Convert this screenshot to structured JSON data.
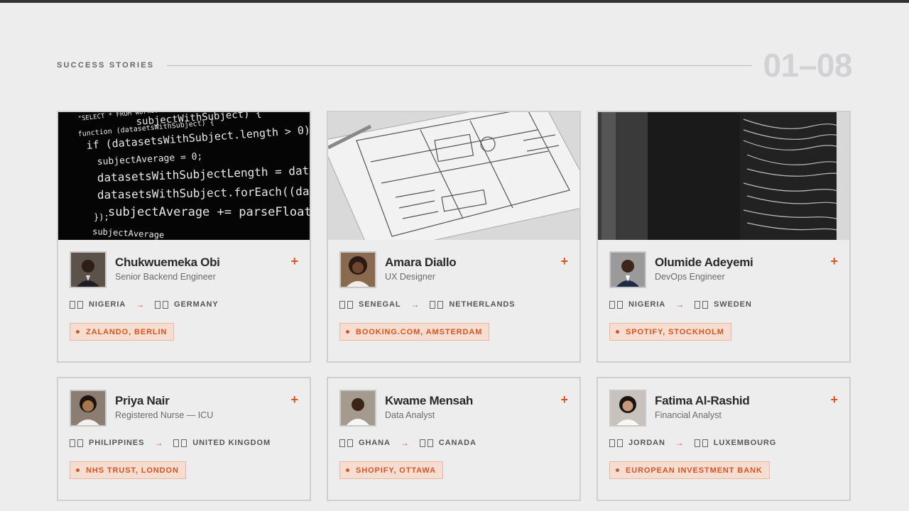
{
  "section": {
    "title": "SUCCESS STORIES",
    "range": "01–08"
  },
  "colors": {
    "accent": "#d9541e",
    "background": "#ededee",
    "range_text": "#d2d2d4"
  },
  "cards": [
    {
      "name": "Chukwuemeka Obi",
      "role": "Senior Backend Engineer",
      "from": "NIGERIA",
      "to": "GERMANY",
      "employer": "ZALANDO, BERLIN",
      "photo": "code-editor-photo",
      "code": {
        "l1": "\"SELECT * FROM workout",
        "l2": "subjectWithSubject) {",
        "l3": "function (datasetsWithSubject) {",
        "l4": "if (datasetsWithSubject.length > 0) {",
        "l5": "subjectAverage = 0;",
        "l6": "datasetsWithSubjectLength = datasetsWithSu",
        "l7": "datasetsWithSubject.forEach((dataset) => {",
        "l8": "subjectAverage += parseFloat(dataset[\"",
        "l9": "});",
        "l10": "subjectAverage"
      }
    },
    {
      "name": "Amara Diallo",
      "role": "UX Designer",
      "from": "SENEGAL",
      "to": "NETHERLANDS",
      "employer": "BOOKING.COM, AMSTERDAM",
      "photo": "wireframe-sketch-photo"
    },
    {
      "name": "Olumide Adeyemi",
      "role": "DevOps Engineer",
      "from": "NIGERIA",
      "to": "SWEDEN",
      "employer": "SPOTIFY, STOCKHOLM",
      "photo": "server-rack-photo"
    },
    {
      "name": "Priya Nair",
      "role": "Registered Nurse — ICU",
      "from": "PHILIPPINES",
      "to": "UNITED KINGDOM",
      "employer": "NHS TRUST, LONDON"
    },
    {
      "name": "Kwame Mensah",
      "role": "Data Analyst",
      "from": "GHANA",
      "to": "CANADA",
      "employer": "SHOPIFY, OTTAWA"
    },
    {
      "name": "Fatima Al-Rashid",
      "role": "Financial Analyst",
      "from": "JORDAN",
      "to": "LUXEMBOURG",
      "employer": "EUROPEAN INVESTMENT BANK"
    }
  ],
  "icons": {
    "expand": "+",
    "route_arrow": "→"
  }
}
